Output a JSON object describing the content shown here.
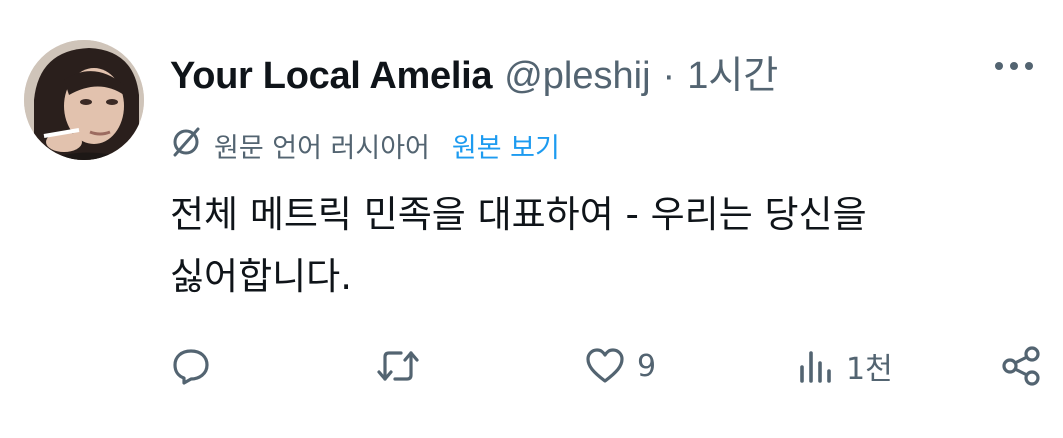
{
  "tweet": {
    "author_name": "Your Local Amelia",
    "handle": "@pleshij",
    "separator": "·",
    "time": "1시간",
    "translation_notice": "원문 언어 러시아어",
    "show_original_label": "원본 보기",
    "text": "전체 메트릭 민족을 대표하여 - 우리는 당신을 싫어합니다.",
    "icons": {
      "translate": "translate-icon",
      "more": "more-options-icon",
      "reply": "reply-icon",
      "retweet": "retweet-icon",
      "like": "heart-icon",
      "views": "views-chart-icon",
      "share": "share-icon"
    },
    "stats": {
      "likes": "9",
      "views": "1천"
    }
  },
  "colors": {
    "text": "#0f1419",
    "secondary": "#536471",
    "link": "#1d9bf0",
    "background": "#ffffff"
  }
}
